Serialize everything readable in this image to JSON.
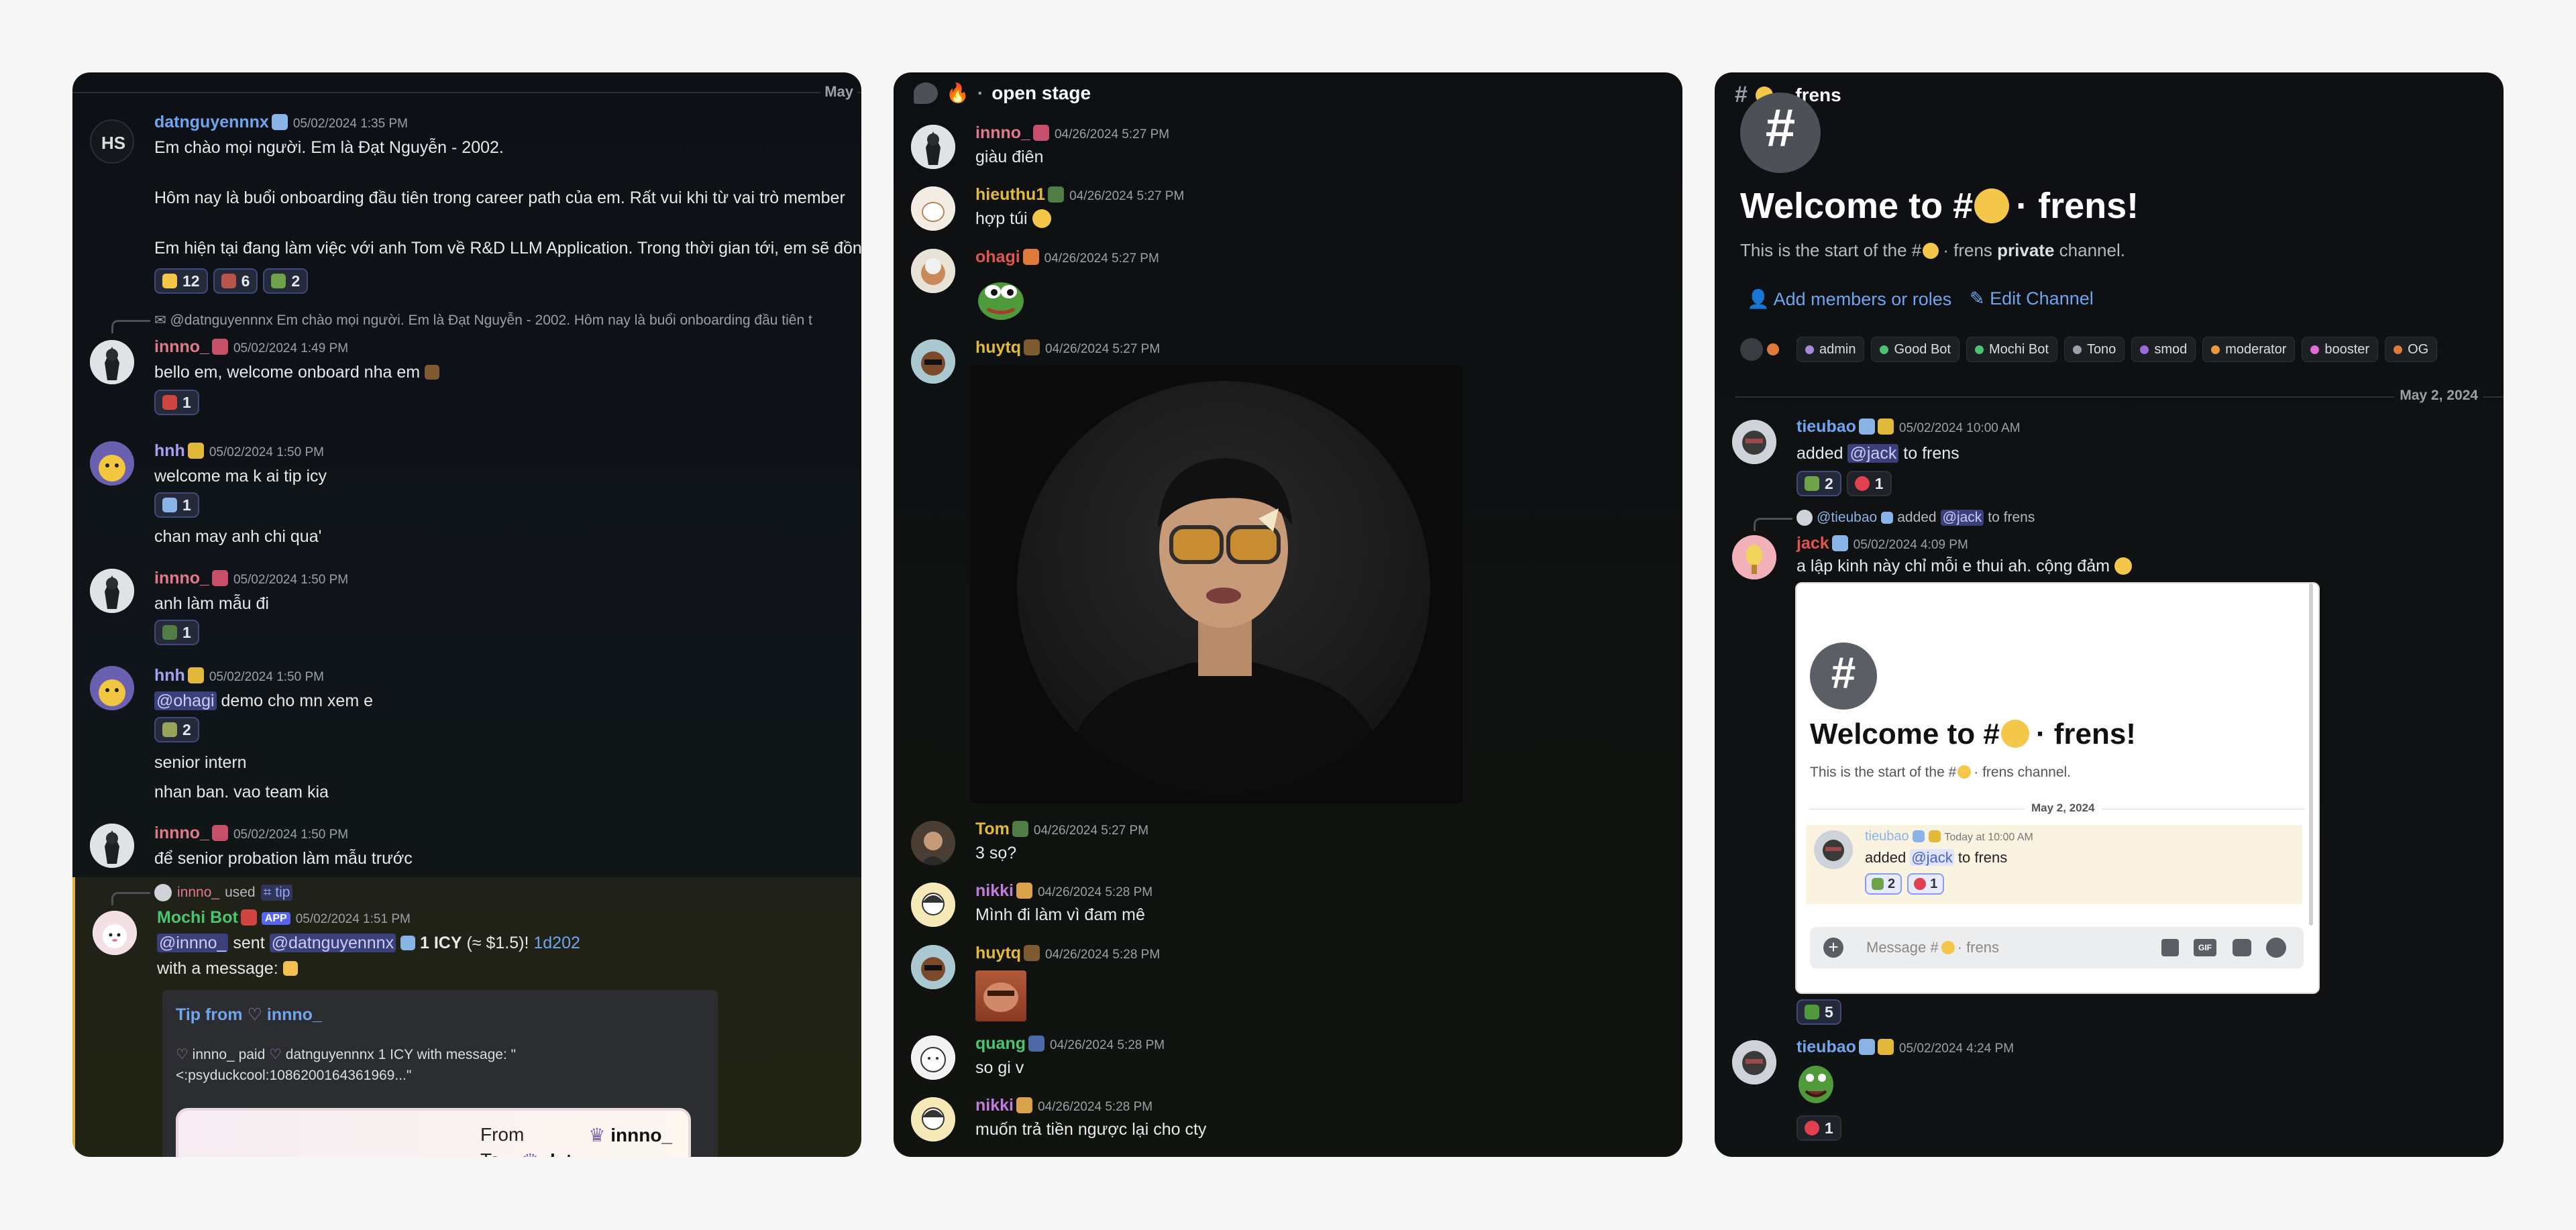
{
  "panel1": {
    "top_date": "May",
    "messages": [
      {
        "name": "datnguyennnx",
        "ts": "05/02/2024 1:35 PM",
        "lines": [
          "Em chào mọi người. Em là Đạt Nguyễn - 2002.",
          "Hôm nay là buổi onboarding đầu tiên trong career path của em. Rất vui khi từ vai trò member",
          "Em hiện tại đang làm việc với anh Tom về R&D LLM Application. Trong thời gian tới, em sẽ đồng"
        ],
        "reactions": [
          "12",
          "6",
          "2"
        ]
      },
      {
        "reply": "@datnguyennnx Em chào mọi người. Em là Đạt Nguyễn - 2002.   Hôm nay là buổi onboarding đầu tiên t",
        "name": "innno_",
        "ts": "05/02/2024 1:49 PM",
        "lines": [
          "bello em, welcome onboard nha em"
        ],
        "reactions": [
          "1"
        ]
      },
      {
        "name": "hnh",
        "ts": "05/02/2024 1:50 PM",
        "lines": [
          "welcome ma k ai tip icy",
          "chan may anh chi qua'"
        ],
        "reactions": [
          "1"
        ]
      },
      {
        "name": "innno_",
        "ts": "05/02/2024 1:50 PM",
        "lines": [
          "anh làm mẫu đi"
        ],
        "reactions": [
          "1"
        ]
      },
      {
        "name": "hnh",
        "ts": "05/02/2024 1:50 PM",
        "mention": "@ohagi",
        "mention_rest": " demo cho mn xem e",
        "lines": [
          "senior intern",
          "nhan ban. vao team kia"
        ],
        "reactions": [
          "2"
        ]
      },
      {
        "name": "innno_",
        "ts": "05/02/2024 1:50 PM",
        "lines": [
          "để senior probation làm mẫu trước"
        ]
      }
    ],
    "bot": {
      "used_user": "innno_",
      "used_word": "used",
      "used_cmd": "tip",
      "name": "Mochi Bot",
      "app_tag": "APP",
      "ts": "05/02/2024 1:51 PM",
      "from_mention": "@innno_",
      "sent_word": "sent",
      "to_mention": "@datnguyennnx",
      "amount": "1 ICY",
      "approx": "(≈ $1.5)!",
      "tx": "1d202",
      "with_msg": "with a message:",
      "embed_title_prefix": "Tip from",
      "embed_title_user": "innno_",
      "embed_line1": "innno_ paid",
      "embed_line1b": "datnguyennnx 1 ICY with message: \"",
      "embed_line2": "<:psyduckcool:1086200164361969...\"",
      "card_from_label": "From",
      "card_from": "innno_",
      "card_to_label": "To",
      "card_to": "datnguyennnx"
    }
  },
  "panel2": {
    "channel": "open stage",
    "messages": [
      {
        "name": "innno_",
        "ts": "04/26/2024 5:27 PM",
        "text": "giàu điên"
      },
      {
        "name": "hieuthu1",
        "ts": "04/26/2024 5:27 PM",
        "text": "hợp túi"
      },
      {
        "name": "ohagi",
        "ts": "04/26/2024 5:27 PM",
        "text": ""
      },
      {
        "name": "huytq",
        "ts": "04/26/2024 5:27 PM",
        "text": ""
      },
      {
        "name": "Tom",
        "ts": "04/26/2024 5:27 PM",
        "text": "3 sọ?"
      },
      {
        "name": "nikki",
        "ts": "04/26/2024 5:28 PM",
        "text": "Mình đi làm vì đam mê"
      },
      {
        "name": "huytq",
        "ts": "04/26/2024 5:28 PM",
        "text": ""
      },
      {
        "name": "quang",
        "ts": "04/26/2024 5:28 PM",
        "text": "so gi v"
      },
      {
        "name": "nikki",
        "ts": "04/26/2024 5:28 PM",
        "text": "muốn trả tiền ngược lại cho cty"
      }
    ]
  },
  "panel3": {
    "channel": "frens",
    "welcome_prefix": "Welcome to #",
    "welcome_suffix": "· frens!",
    "start_prefix": "This is the start of the #",
    "start_mid": "· frens",
    "start_bold": "private",
    "start_suffix": "channel.",
    "add_members": "Add members or roles",
    "edit_channel": "Edit Channel",
    "roles": [
      {
        "label": "admin",
        "color": "#a48bd8"
      },
      {
        "label": "Good Bot",
        "color": "#4bc46e"
      },
      {
        "label": "Mochi Bot",
        "color": "#4bc46e"
      },
      {
        "label": "Tono",
        "color": "#9aa0a6"
      },
      {
        "label": "smod",
        "color": "#9b6bd8"
      },
      {
        "label": "moderator",
        "color": "#e79a3c"
      },
      {
        "label": "booster",
        "color": "#e36bd8"
      },
      {
        "label": "OG",
        "color": "#e07a3b"
      }
    ],
    "divider_date": "May 2, 2024",
    "m1": {
      "name": "tieubao",
      "ts": "05/02/2024 10:00 AM",
      "added": "added",
      "mention": "@jack",
      "to": "to frens",
      "r1": "2",
      "r2": "1"
    },
    "m2": {
      "reply_user": "@tieubao",
      "reply_text": "added",
      "reply_mention": "@jack",
      "reply_tail": "to frens",
      "name": "jack",
      "ts": "05/02/2024 4:09 PM",
      "text": "a lập kinh này chỉ mỗi e thui ah. cộng đảm",
      "r1": "5"
    },
    "shot": {
      "title_prefix": "Welcome to #",
      "title_suffix": "· frens!",
      "start": "This is the start of the #",
      "start_tail": "· frens channel.",
      "date": "May 2, 2024",
      "user": "tieubao",
      "ts": "Today at 10:00 AM",
      "added": "added",
      "mention": "@jack",
      "to": "to frens",
      "r1": "2",
      "r2": "1",
      "input_placeholder": "Message #",
      "input_tail": "· frens"
    },
    "m3": {
      "name": "tieubao",
      "ts": "05/02/2024 4:24 PM",
      "r1": "1"
    }
  }
}
